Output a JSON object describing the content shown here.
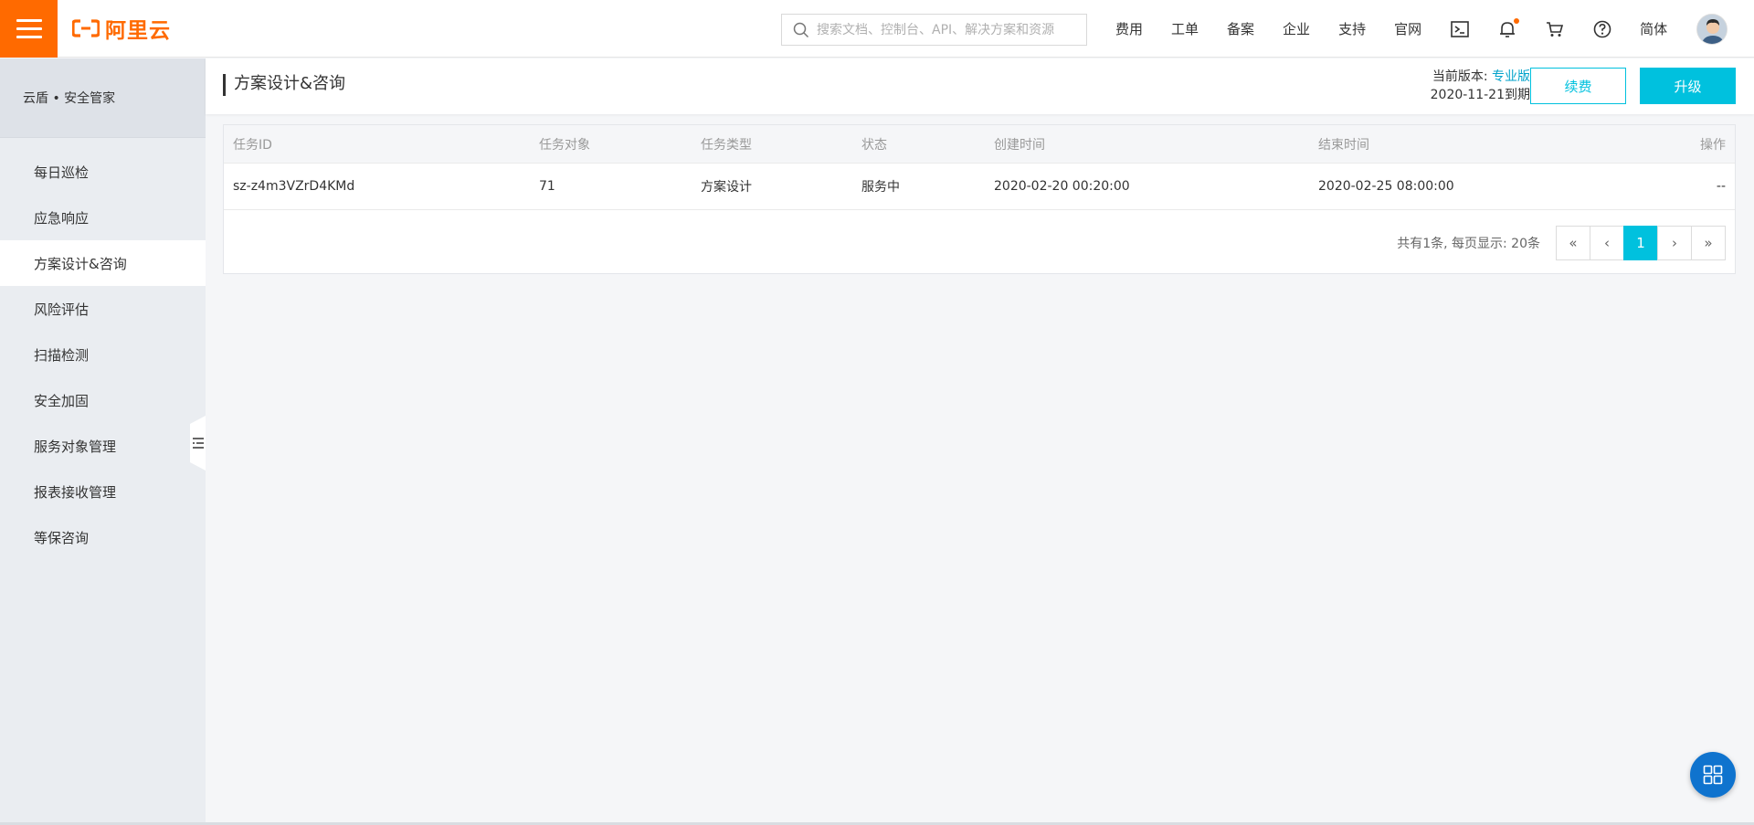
{
  "header": {
    "logo_text": "阿里云",
    "search_placeholder": "搜索文档、控制台、API、解决方案和资源",
    "nav": [
      "费用",
      "工单",
      "备案",
      "企业",
      "支持",
      "官网"
    ],
    "icons": [
      "terminal-icon",
      "bell-icon",
      "cart-icon",
      "help-icon"
    ],
    "language": "简体"
  },
  "sidebar": {
    "title": "云盾 • 安全管家",
    "items": [
      {
        "label": "每日巡检"
      },
      {
        "label": "应急响应"
      },
      {
        "label": "方案设计&咨询"
      },
      {
        "label": "风险评估"
      },
      {
        "label": "扫描检测"
      },
      {
        "label": "安全加固"
      },
      {
        "label": "服务对象管理"
      },
      {
        "label": "报表接收管理"
      },
      {
        "label": "等保咨询"
      }
    ],
    "active_index": 2
  },
  "content": {
    "page_title": "方案设计&咨询",
    "version_label": "当前版本:",
    "version_name": "专业版",
    "expire_text": "2020-11-21到期",
    "renew_label": "续费",
    "upgrade_label": "升级"
  },
  "table": {
    "columns": [
      "任务ID",
      "任务对象",
      "任务类型",
      "状态",
      "创建时间",
      "结束时间",
      "操作"
    ],
    "rows": [
      [
        "sz-z4m3VZrD4KMd",
        "71",
        "方案设计",
        "服务中",
        "2020-02-20 00:20:00",
        "2020-02-25 08:00:00",
        "--"
      ]
    ]
  },
  "pagination": {
    "summary": "共有1条, 每页显示: 20条",
    "first": "«",
    "prev": "‹",
    "current": "1",
    "next": "›",
    "last": "»"
  },
  "colors": {
    "brand": "#ff6a00",
    "accent": "#00c1de",
    "float_button": "#0f73ce"
  }
}
